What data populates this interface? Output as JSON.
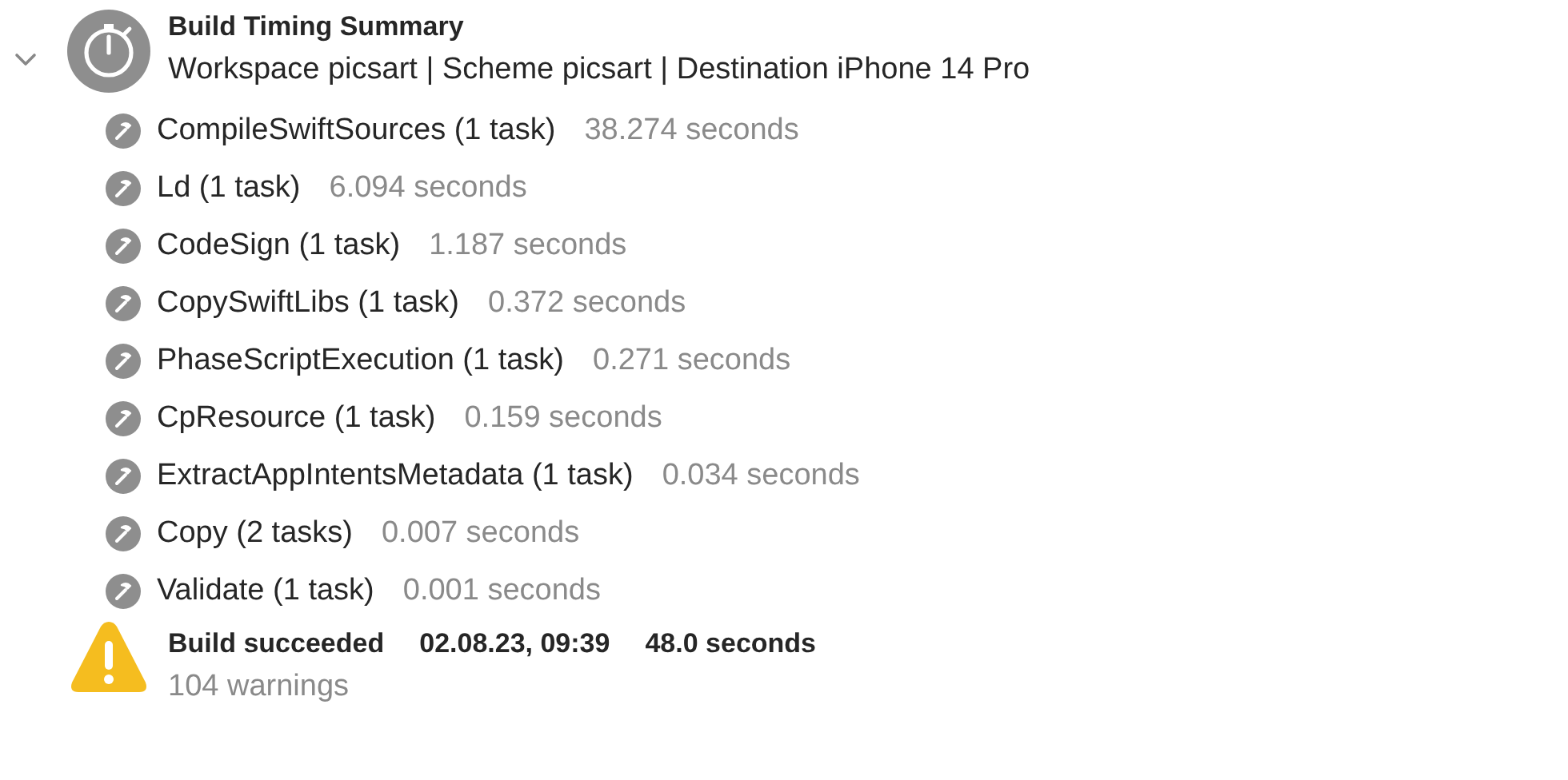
{
  "summary": {
    "expanded": true,
    "title": "Build Timing Summary",
    "subtitle": "Workspace picsart | Scheme picsart | Destination iPhone 14 Pro"
  },
  "tasks": [
    {
      "name": "CompileSwiftSources (1 task)",
      "duration": "38.274 seconds"
    },
    {
      "name": "Ld (1 task)",
      "duration": "6.094 seconds"
    },
    {
      "name": "CodeSign (1 task)",
      "duration": "1.187 seconds"
    },
    {
      "name": "CopySwiftLibs (1 task)",
      "duration": "0.372 seconds"
    },
    {
      "name": "PhaseScriptExecution (1 task)",
      "duration": "0.271 seconds"
    },
    {
      "name": "CpResource (1 task)",
      "duration": "0.159 seconds"
    },
    {
      "name": "ExtractAppIntentsMetadata (1 task)",
      "duration": "0.034 seconds"
    },
    {
      "name": "Copy (2 tasks)",
      "duration": "0.007 seconds"
    },
    {
      "name": "Validate (1 task)",
      "duration": "0.001 seconds"
    }
  ],
  "result": {
    "status": "Build succeeded",
    "date": "02.08.23, 09:39",
    "duration": "48.0 seconds",
    "warnings": "104 warnings"
  }
}
